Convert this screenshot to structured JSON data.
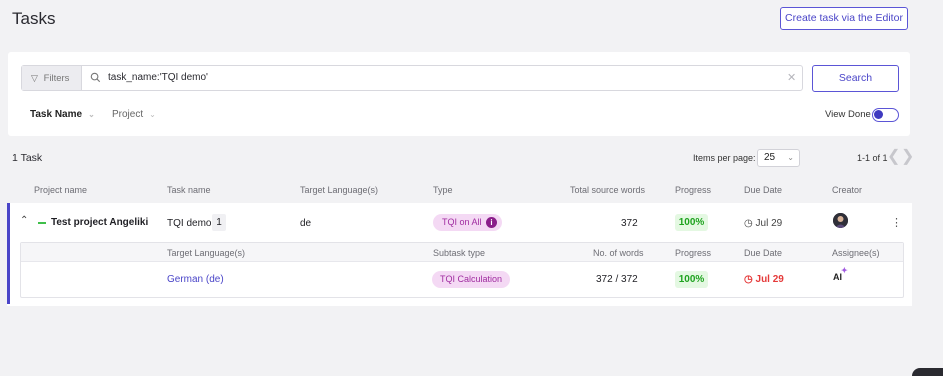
{
  "header": {
    "title": "Tasks",
    "create_button": "Create task via the Editor"
  },
  "filters": {
    "filters_label": "Filters",
    "query": "task_name:'TQI demo'",
    "search_button": "Search",
    "sort_task_name": "Task Name",
    "sort_project": "Project",
    "view_done_label": "View Done",
    "view_done_on": true
  },
  "results": {
    "count_label": "1 Task",
    "items_per_page_label": "Items per page:",
    "items_per_page_value": "25",
    "range_label": "1-1 of 1"
  },
  "columns": {
    "project": "Project name",
    "task": "Task name",
    "target": "Target Language(s)",
    "type": "Type",
    "words": "Total source words",
    "progress": "Progress",
    "due": "Due Date",
    "creator": "Creator"
  },
  "task": {
    "project_name": "Test project Angeliki",
    "task_name": "TQI demo",
    "subtask_count": "1",
    "target_language": "de",
    "type": "TQI on All",
    "total_words": "372",
    "progress": "100%",
    "due_date": "Jul 29"
  },
  "subtask_columns": {
    "target": "Target Language(s)",
    "subtask_type": "Subtask type",
    "words": "No. of words",
    "progress": "Progress",
    "due": "Due Date",
    "assignee": "Assignee(s)"
  },
  "subtask": {
    "target_language": "German (de)",
    "subtask_type": "TQI Calculation",
    "words": "372 / 372",
    "progress": "100%",
    "due_date": "Jul 29",
    "assignee": "AI"
  },
  "colors": {
    "accent": "#4a45c8",
    "progress_green": "#1fa31f",
    "due_red": "#e53a3a",
    "pill_pink": "#f4d9f4"
  }
}
